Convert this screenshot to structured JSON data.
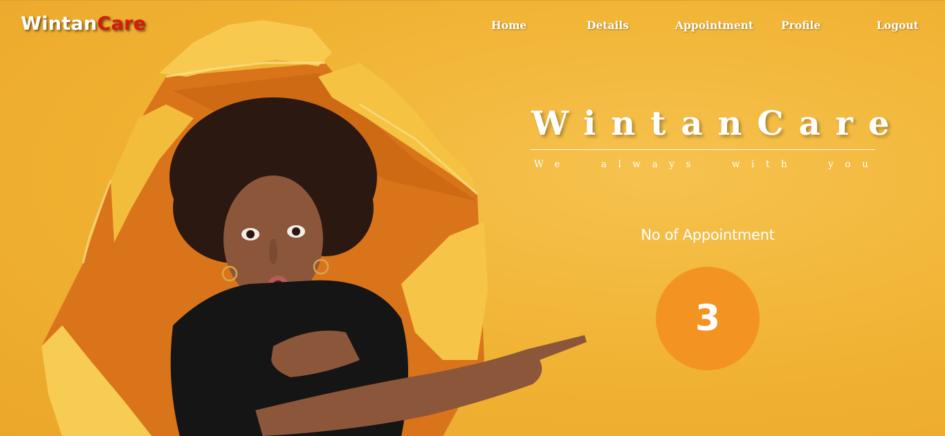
{
  "brand": {
    "part1": "Wintan",
    "part2": "Care"
  },
  "nav": {
    "home": "Home",
    "details": "Details",
    "appointment": "Appointment",
    "profile": "Profile",
    "logout": "Logout"
  },
  "hero": {
    "title": "WintanCare",
    "tagline": "We always with you",
    "count_label": "No of Appointment",
    "count_value": "3",
    "image_alt": "woman-pointing-through-torn-paper"
  },
  "colors": {
    "background": "#f0b232",
    "accent_circle": "#f39322",
    "brand_red": "#d61a0f",
    "text": "#ffffff"
  }
}
